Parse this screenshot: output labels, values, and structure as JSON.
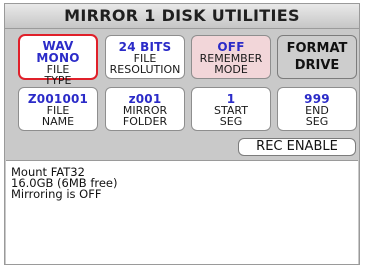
{
  "title": "MIRROR 1 DISK UTILITIES",
  "row1": [
    {
      "value": "WAV MONO",
      "label1": "FILE",
      "label2": "TYPE"
    },
    {
      "value": "24 BITS",
      "label1": "FILE",
      "label2": "RESOLUTION"
    },
    {
      "value": "OFF",
      "label1": "REMEMBER",
      "label2": "MODE"
    },
    {
      "line1": "FORMAT",
      "line2": "DRIVE"
    }
  ],
  "row2": [
    {
      "value": "Z001001",
      "label1": "FILE",
      "label2": "NAME"
    },
    {
      "value": "z001",
      "label1": "MIRROR",
      "label2": "FOLDER"
    },
    {
      "value": "1",
      "label1": "START",
      "label2": "SEG"
    },
    {
      "value": "999",
      "label1": "END",
      "label2": "SEG"
    }
  ],
  "rec_enable_label": "REC ENABLE",
  "status_lines": [
    "Mount FAT32",
    "16.0GB (6MB free)",
    "Mirroring is OFF"
  ],
  "colors": {
    "selected_border": "#e0202a",
    "value_text": "#2b2bc8",
    "remember_mode_bg": "#f2d6d9"
  }
}
